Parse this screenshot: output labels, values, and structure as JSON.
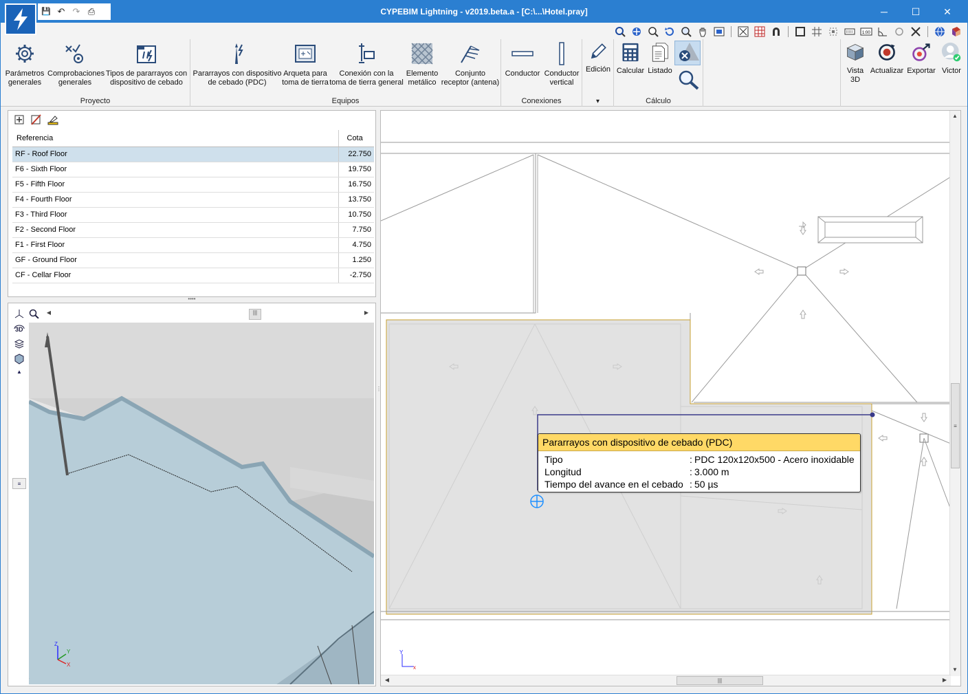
{
  "window": {
    "title": "CYPEBIM Lightning - v2019.beta.a - [C:\\...\\Hotel.pray]",
    "buttons": {
      "minimize": "─",
      "maximize": "☐",
      "close": "✕"
    }
  },
  "quick_access": {
    "save": "💾",
    "undo": "↶",
    "redo": "↷",
    "print": "⎙"
  },
  "ribbon": {
    "proyecto": {
      "title": "Proyecto",
      "parametros": [
        "Parámetros",
        "generales"
      ],
      "comprobaciones": [
        "Comprobaciones",
        "generales"
      ],
      "tipos": [
        "Tipos de pararrayos con",
        "dispositivo de cebado"
      ]
    },
    "equipos": {
      "title": "Equipos",
      "pdc": [
        "Pararrayos con dispositivo",
        "de cebado (PDC)"
      ],
      "arqueta": [
        "Arqueta para",
        "toma de tierra"
      ],
      "conexion": [
        "Conexión con la",
        "toma de tierra general"
      ],
      "elemento": [
        "Elemento",
        "metálico"
      ],
      "conjunto": [
        "Conjunto",
        "receptor (antena)"
      ]
    },
    "conexiones": {
      "title": "Conexiones",
      "conductor": [
        "Conductor",
        ""
      ],
      "vertical": [
        "Conductor",
        "vertical"
      ]
    },
    "edicion": {
      "label": "Edición",
      "arrow": "▾"
    },
    "calculo": {
      "title": "Cálculo",
      "calcular": "Calcular",
      "listado": "Listado"
    },
    "extra": {
      "vista3d": [
        "Vista",
        "3D"
      ],
      "actualizar": "Actualizar",
      "exportar": "Exportar",
      "user": "Victor"
    }
  },
  "floors": {
    "headers": {
      "ref": "Referencia",
      "cota": "Cota"
    },
    "rows": [
      {
        "ref": "RF - Roof Floor",
        "cota": "22.750"
      },
      {
        "ref": "F6 - Sixth Floor",
        "cota": "19.750"
      },
      {
        "ref": "F5 - Fifth Floor",
        "cota": "16.750"
      },
      {
        "ref": "F4 - Fourth Floor",
        "cota": "13.750"
      },
      {
        "ref": "F3 - Third Floor",
        "cota": "10.750"
      },
      {
        "ref": "F2 - Second Floor",
        "cota": "7.750"
      },
      {
        "ref": "F1 - First Floor",
        "cota": "4.750"
      },
      {
        "ref": "GF - Ground Floor",
        "cota": "1.250"
      },
      {
        "ref": "CF - Cellar Floor",
        "cota": "-2.750"
      }
    ],
    "selected_index": 0
  },
  "view3d": {
    "label_3d": "3D",
    "axis_x": "X",
    "axis_y": "Y",
    "axis_z": "Z"
  },
  "drawing": {
    "axis_x": "x",
    "axis_y": "Y"
  },
  "tooltip": {
    "title": "Pararrayos con dispositivo de cebado (PDC)",
    "rows": [
      {
        "label": "Tipo",
        "value": "PDC 120x120x500 - Acero inoxidable"
      },
      {
        "label": "Longitud",
        "value": "3.000 m"
      },
      {
        "label": "Tiempo del avance en el cebado",
        "value": "50 µs"
      }
    ],
    "sep": ":"
  },
  "colors": {
    "titlebar": "#2b7fd1",
    "selection": "#cfe0ec",
    "tooltip_header": "#ffd966",
    "roof": "#b7cdd8",
    "highlight_line": "#c8a030",
    "link_line": "#3a3a8a",
    "cursor": "#1e90ff"
  }
}
